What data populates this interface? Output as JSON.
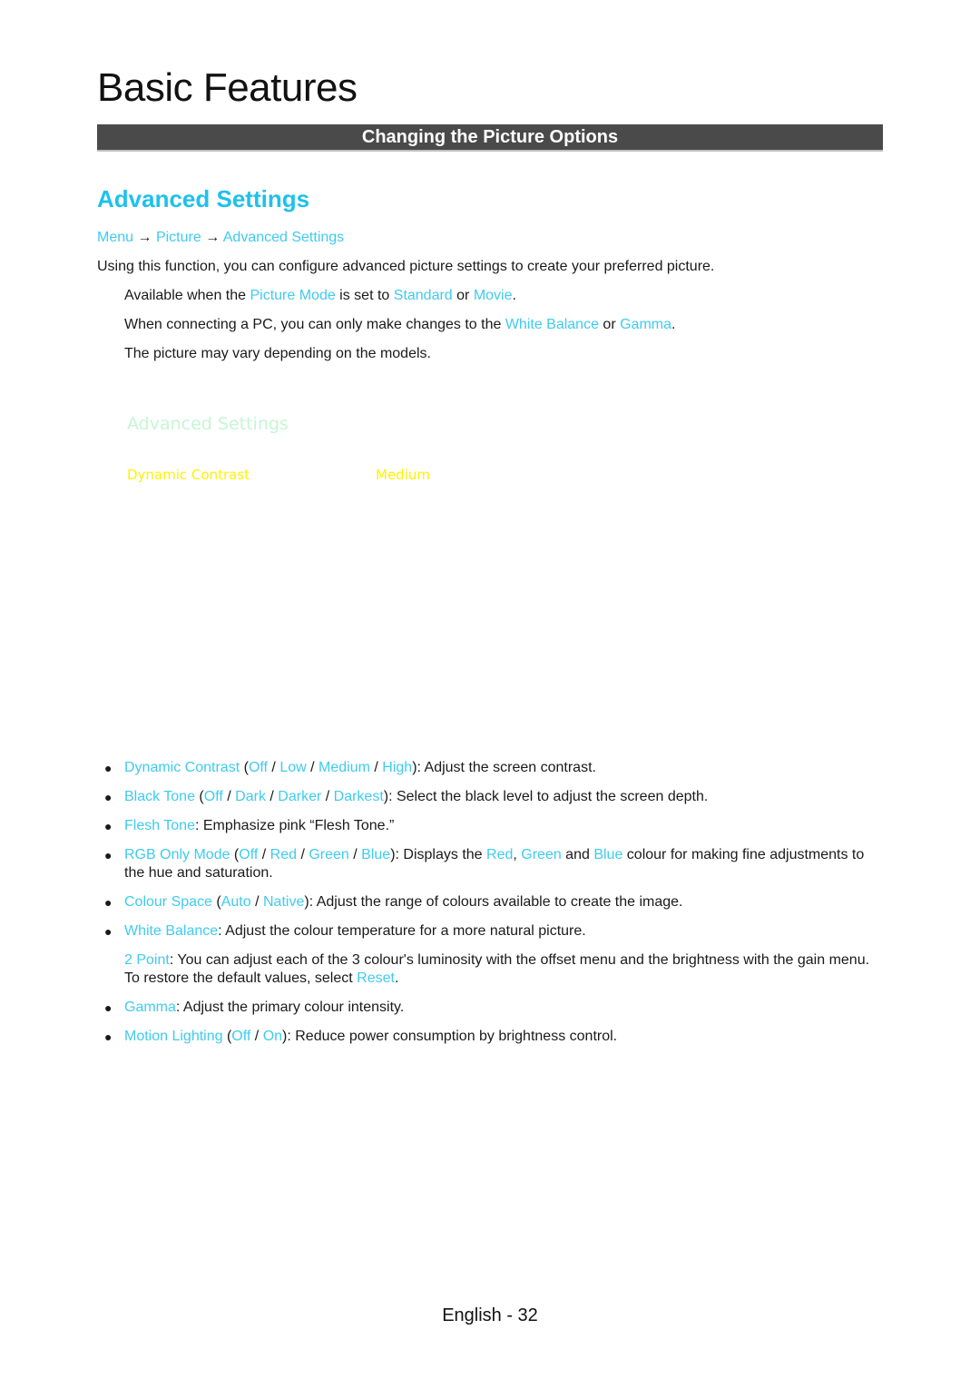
{
  "chapter_title": "Basic Features",
  "section_bar": "Changing the Picture Options",
  "subsection_title": "Advanced Settings",
  "breadcrumb": {
    "items": [
      "Menu",
      "Picture",
      "Advanced Settings"
    ],
    "separator": "→"
  },
  "intro": "Using this function, you can configure advanced picture settings to create your preferred picture.",
  "notes": [
    {
      "parts": [
        "Available when the ",
        "Picture Mode",
        " is set to ",
        "Standard",
        " or ",
        "Movie",
        "."
      ]
    },
    {
      "parts": [
        "When connecting a PC, you can only make changes to the ",
        "White Balance",
        " or ",
        "Gamma",
        "."
      ]
    },
    {
      "parts": [
        "The picture may vary depending on the models."
      ]
    }
  ],
  "osd": {
    "title": "Advanced Settings",
    "rows": [
      {
        "label": "Dynamic Contrast",
        "value": "Medium"
      }
    ]
  },
  "bullets": [
    {
      "parts": [
        "Dynamic Contrast",
        " (",
        "Off",
        " / ",
        "Low",
        " / ",
        "Medium",
        " / ",
        "High",
        "): Adjust the screen contrast."
      ]
    },
    {
      "parts": [
        "Black Tone",
        " (",
        "Off",
        " / ",
        "Dark",
        " / ",
        "Darker",
        " / ",
        "Darkest",
        "): Select the black level to adjust the screen depth."
      ]
    },
    {
      "parts": [
        "Flesh Tone",
        ": Emphasize pink “Flesh Tone.”"
      ]
    },
    {
      "parts": [
        "RGB Only Mode",
        " (",
        "Off",
        " / ",
        "Red",
        " / ",
        "Green",
        " / ",
        "Blue",
        "): Displays the ",
        "Red",
        ", ",
        "Green",
        " and ",
        "Blue",
        " colour for making fine adjustments to the hue and saturation."
      ]
    },
    {
      "parts": [
        "Colour Space",
        " (",
        "Auto",
        " / ",
        "Native",
        "): Adjust the range of colours available to create the image."
      ]
    },
    {
      "parts": [
        "White Balance",
        ": Adjust the colour temperature for a more natural picture."
      ]
    }
  ],
  "white_balance_sub": {
    "parts": [
      "2 Point",
      ": You can adjust each of the 3 colour's luminosity with the offset menu and the brightness with the gain menu. To restore the default values, select ",
      "Reset",
      "."
    ]
  },
  "bullets2": [
    {
      "parts": [
        "Gamma",
        ": Adjust the primary colour intensity."
      ]
    },
    {
      "parts": [
        "Motion Lighting",
        " (",
        "Off",
        " / ",
        "On",
        "): Reduce power consumption by brightness control."
      ]
    }
  ],
  "footer": "English - 32",
  "colors": {
    "accent": "#1ec1ec",
    "link": "#3fcbef",
    "bar": "#4a4a4a",
    "osd_title": "#c6f6d3",
    "osd_text": "#fff200"
  }
}
